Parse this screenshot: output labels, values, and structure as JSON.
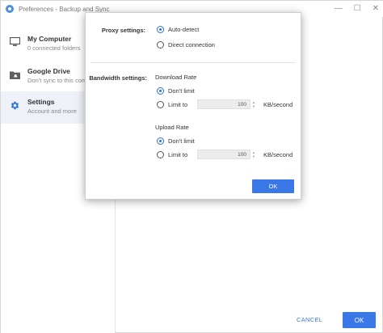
{
  "window": {
    "title": "Preferences - Backup and Sync",
    "controls": {
      "minimize": "—",
      "maximize": "☐",
      "close": "✕"
    }
  },
  "sidebar": {
    "items": [
      {
        "title": "My Computer",
        "subtitle": "0 connected folders",
        "icon": "monitor-icon"
      },
      {
        "title": "Google Drive",
        "subtitle": "Don't sync to this comput",
        "icon": "drive-folder-icon"
      },
      {
        "title": "Settings",
        "subtitle": "Account and more",
        "icon": "gear-icon",
        "active": true
      }
    ]
  },
  "footer": {
    "cancel_label": "CANCEL",
    "ok_label": "OK"
  },
  "dialog": {
    "proxy": {
      "label": "Proxy settings:",
      "options": [
        {
          "label": "Auto-detect",
          "checked": true
        },
        {
          "label": "Direct connection",
          "checked": false
        }
      ]
    },
    "bandwidth": {
      "label": "Bandwidth settings:",
      "download": {
        "heading": "Download Rate",
        "options": [
          {
            "label": "Don't limit",
            "checked": true
          },
          {
            "label": "Limit to",
            "checked": false
          }
        ],
        "value": "100",
        "unit": "KB/second"
      },
      "upload": {
        "heading": "Upload Rate",
        "options": [
          {
            "label": "Don't limit",
            "checked": true
          },
          {
            "label": "Limit to",
            "checked": false
          }
        ],
        "value": "100",
        "unit": "KB/second"
      }
    },
    "ok_label": "OK"
  },
  "colors": {
    "accent": "#3b78e7",
    "active_bg": "#eef2f8"
  }
}
